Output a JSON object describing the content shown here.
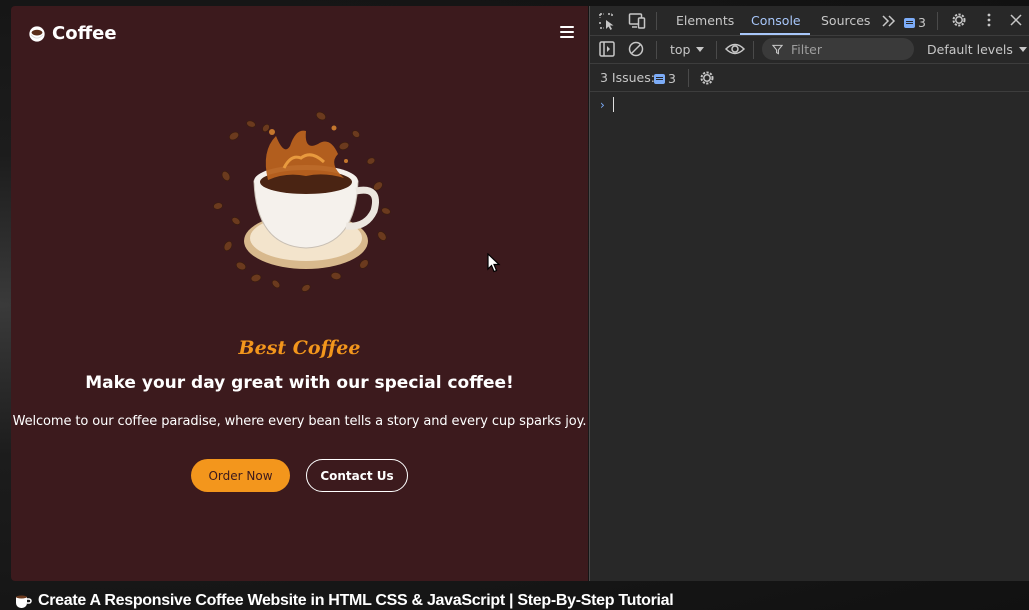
{
  "site": {
    "brand": "Coffee",
    "tagline": "Best Coffee",
    "headline": "Make your day great with our special coffee!",
    "description": "Welcome to our coffee paradise, where every bean tells a story and every cup sparks joy.",
    "order_label": "Order Now",
    "contact_label": "Contact Us",
    "colors": {
      "background": "#3c1a1d",
      "accent": "#f3961c"
    }
  },
  "devtools": {
    "tabs": [
      "Elements",
      "Console",
      "Sources"
    ],
    "active_tab": "Console",
    "issue_count": "3",
    "context": "top",
    "filter_placeholder": "Filter",
    "levels": "Default levels",
    "issues_label": "3 Issues:",
    "issues_count": "3",
    "icons": [
      "inspect-icon",
      "device-toggle-icon",
      "more-tabs-icon",
      "settings-icon",
      "kebab-menu-icon",
      "close-icon",
      "sidebar-icon",
      "clear-console-icon",
      "eye-icon",
      "filter-icon"
    ]
  },
  "video": {
    "title": "Create A Responsive Coffee Website in HTML CSS & JavaScript | Step-By-Step Tutorial"
  }
}
